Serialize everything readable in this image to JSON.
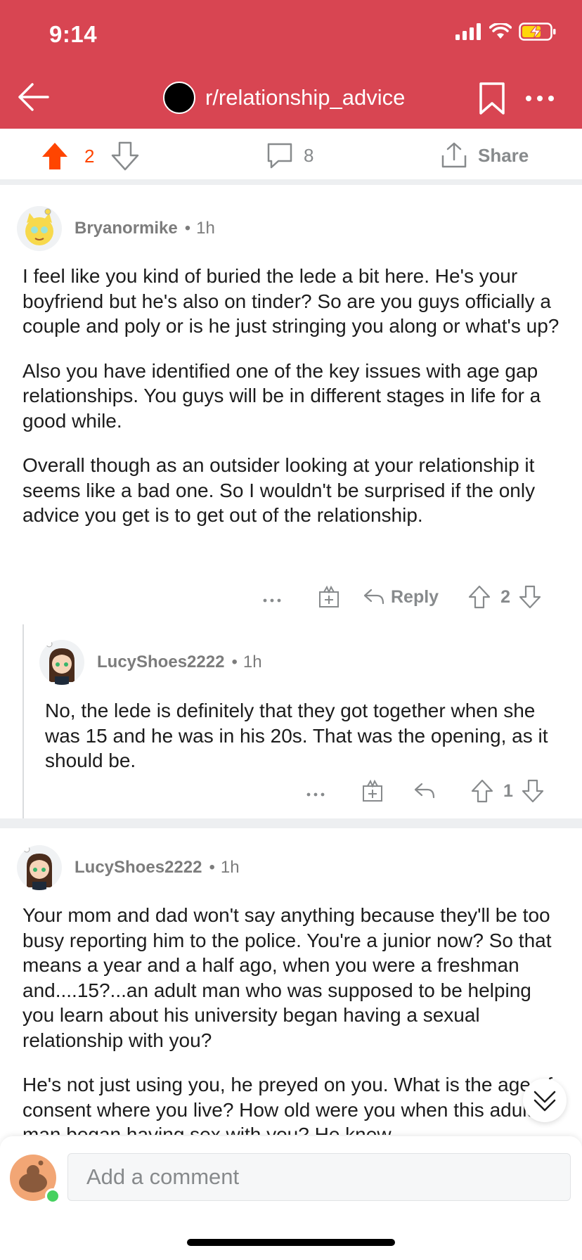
{
  "status_bar": {
    "time": "9:14"
  },
  "header": {
    "subreddit": "r/relationship_advice"
  },
  "post_bar": {
    "upvotes": "2",
    "comments": "8",
    "share_label": "Share"
  },
  "comments": [
    {
      "author": "Bryanormike",
      "dot": "•",
      "age": "1h",
      "paragraphs": [
        "I feel like you kind of buried the lede a bit here. He's your boyfriend but he's also on tinder? So are you guys officially a couple and poly or is he just stringing you along or what's up?",
        "Also you have identified one of the key issues with age gap relationships.  You guys will be in different stages in life for a good while.",
        "Overall though as an outsider looking at your relationship it seems like a bad one. So I wouldn't be surprised if the only advice you get is to get out of the relationship."
      ],
      "reply_label": "Reply",
      "score": "2"
    },
    {
      "author": "LucyShoes2222",
      "dot": "•",
      "age": "1h",
      "paragraphs": [
        "No, the lede is definitely that they got together when she was 15 and he was in his 20s. That was the opening, as it should be."
      ],
      "score": "1"
    },
    {
      "author": "LucyShoes2222",
      "dot": "•",
      "age": "1h",
      "paragraphs": [
        "Your mom and dad won't say anything because they'll be too busy reporting him to the police. You're a junior now? So that means a year and a half ago, when you were a freshman and....15?...an adult man who was supposed to be helping you learn about his university began having a sexual relationship with you?",
        "He's not just using you, he preyed on you. What is the age of consent where you live? How old were you when this adult man began having sex with you? He knew"
      ]
    }
  ],
  "composer": {
    "placeholder": "Add a comment"
  },
  "colors": {
    "header": "#d84552",
    "upvote_active": "#ff4500",
    "meta": "#878a8c"
  }
}
